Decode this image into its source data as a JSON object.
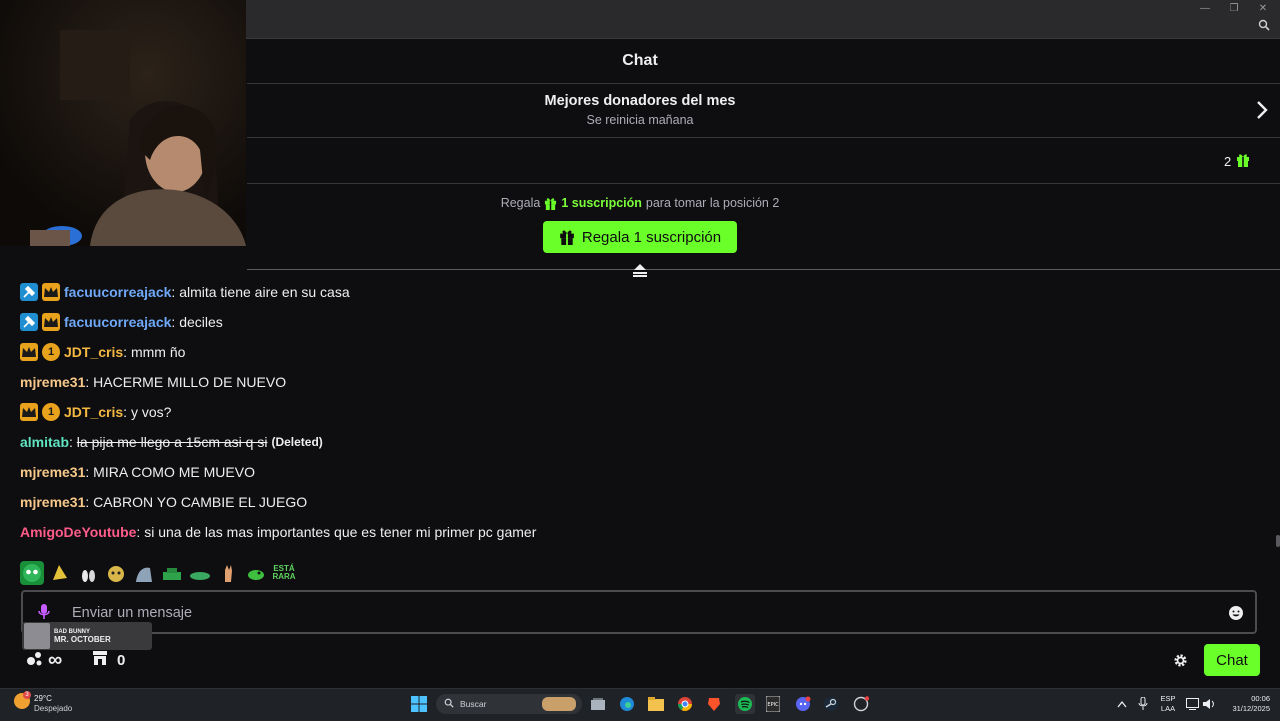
{
  "chat": {
    "title": "Chat",
    "donors_title": "Mejores donadores del mes",
    "donors_subtitle": "Se reinicia mañana",
    "rank_count": "2",
    "gift_prompt_prefix": "Regala",
    "gift_prompt_highlight": "1 suscripción",
    "gift_prompt_suffix": "para tomar la posición 2",
    "gift_button_label": "Regala 1 suscripción"
  },
  "messages": [
    {
      "badges": [
        "mod",
        "crown"
      ],
      "user": "facuucorreajack",
      "color": "#6ea8f7",
      "text": "almita tiene aire en su casa"
    },
    {
      "badges": [
        "mod",
        "crown"
      ],
      "user": "facuucorreajack",
      "color": "#6ea8f7",
      "text": "deciles"
    },
    {
      "badges": [
        "crown",
        "one"
      ],
      "user": "JDT_cris",
      "color": "#f5b942",
      "text": "mmm ño"
    },
    {
      "badges": [],
      "user": "mjreme31",
      "color": "#f7c88a",
      "text": "HACERME MILLO DE NUEVO"
    },
    {
      "badges": [
        "crown",
        "one"
      ],
      "user": "JDT_cris",
      "color": "#f5b942",
      "text": "y vos?"
    },
    {
      "badges": [],
      "user": "almitab",
      "color": "#5fe3c0",
      "text": "la pija me llego a 15cm asi q si",
      "deleted": true,
      "deleted_label": "(Deleted)"
    },
    {
      "badges": [],
      "user": "mjreme31",
      "color": "#f7c88a",
      "text": "MIRA COMO ME MUEVO"
    },
    {
      "badges": [],
      "user": "mjreme31",
      "color": "#f7c88a",
      "text": "CABRON YO CAMBIE EL JUEGO"
    },
    {
      "badges": [],
      "user": "AmigoDeYoutube",
      "color": "#ff5c8a",
      "text": "si una de las mas importantes que es tener mi primer pc gamer"
    }
  ],
  "emote_label_estarara": "ESTÁ RARA",
  "input": {
    "placeholder": "Enviar un mensaje"
  },
  "now_playing": {
    "artist": "BAD BUNNY",
    "title": "MR. OCTOBER"
  },
  "points": {
    "value": "∞",
    "store_count": "0"
  },
  "chat_button_label": "Chat",
  "taskbar": {
    "temperature": "29°C",
    "weather": "Despejado",
    "weather_badge": "3",
    "search_label": "Buscar",
    "lang_line1": "ESP",
    "lang_line2": "LAA",
    "time": "00:06",
    "date": "31/12/2025"
  },
  "colors": {
    "accent_green": "#6bff2a",
    "background": "#0e0e10"
  }
}
